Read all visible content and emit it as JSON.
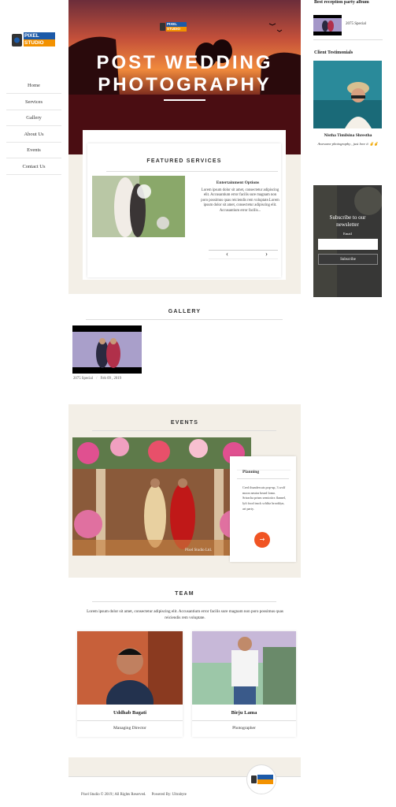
{
  "sidebar": {
    "logo_text": "PIXEL STUDIO",
    "nav": [
      "Home",
      "Services",
      "Gallery",
      "About Us",
      "Events",
      "Contact Us"
    ]
  },
  "hero": {
    "logo_text": "PIXEL STUDIO",
    "title_line1": "POST WEDDING",
    "title_line2": "PHOTOGRAPHY"
  },
  "featured": {
    "heading": "FEATURED SERVICES",
    "item_title": "Entertainment Options",
    "item_text": "Lorem ipsum dolor sit amet, consectetur adipiscing elit. Accusantium error facilis sure magnam non poro possimus quas reiciendis rem voluptate.Lorem ipsum dolor sit amet, consectetur adipiscing elit. Accusantium error facilis...",
    "prev_icon": "‹",
    "next_icon": "›"
  },
  "gallery": {
    "heading": "GALLERY",
    "caption_tag": "2075 Special",
    "caption_sep": "/",
    "caption_date": "Feb 09 , 2019"
  },
  "events": {
    "heading": "EVENTS",
    "card_title": "Planning",
    "card_text": "Cred thundercats pop-up, 3 wolf moon neutra beard lomo. Sriracha prism semiotics flannel, lyft food truck schlitz brooklyn, art party.",
    "watermark": "Pixel Studio Ltd.",
    "arrow_icon": "→"
  },
  "team": {
    "heading": "TEAM",
    "intro": "Lorem ipsum dolor sit amet, consectetur adipiscing elit. Accusantium error facilis sure magnam non poro possimus quas reiciendis rem voluptate.",
    "members": [
      {
        "name": "Uddhab Bagati",
        "role": "Managing Director"
      },
      {
        "name": "Birju Lama",
        "role": "Photographer"
      }
    ]
  },
  "footer": {
    "copyright": "Pixel Studio © 2019 | All Rights Reserved.",
    "powered": "Powered By: Ultrabyte"
  },
  "right": {
    "album_heading": "Best reception party album",
    "album_item": "2075 Special",
    "testimonials_heading": "Client Testimonials",
    "testimonial_name": "Nistha Timilsina Shrestha",
    "testimonial_text": "Awesome photography , just love it",
    "newsletter_heading": "Subscribe to our newsletter",
    "email_label": "Email",
    "subscribe_label": "Subscribe"
  },
  "colors": {
    "accent": "#f05423",
    "logo_blue": "#1c5aa8",
    "logo_orange": "#f39200"
  }
}
